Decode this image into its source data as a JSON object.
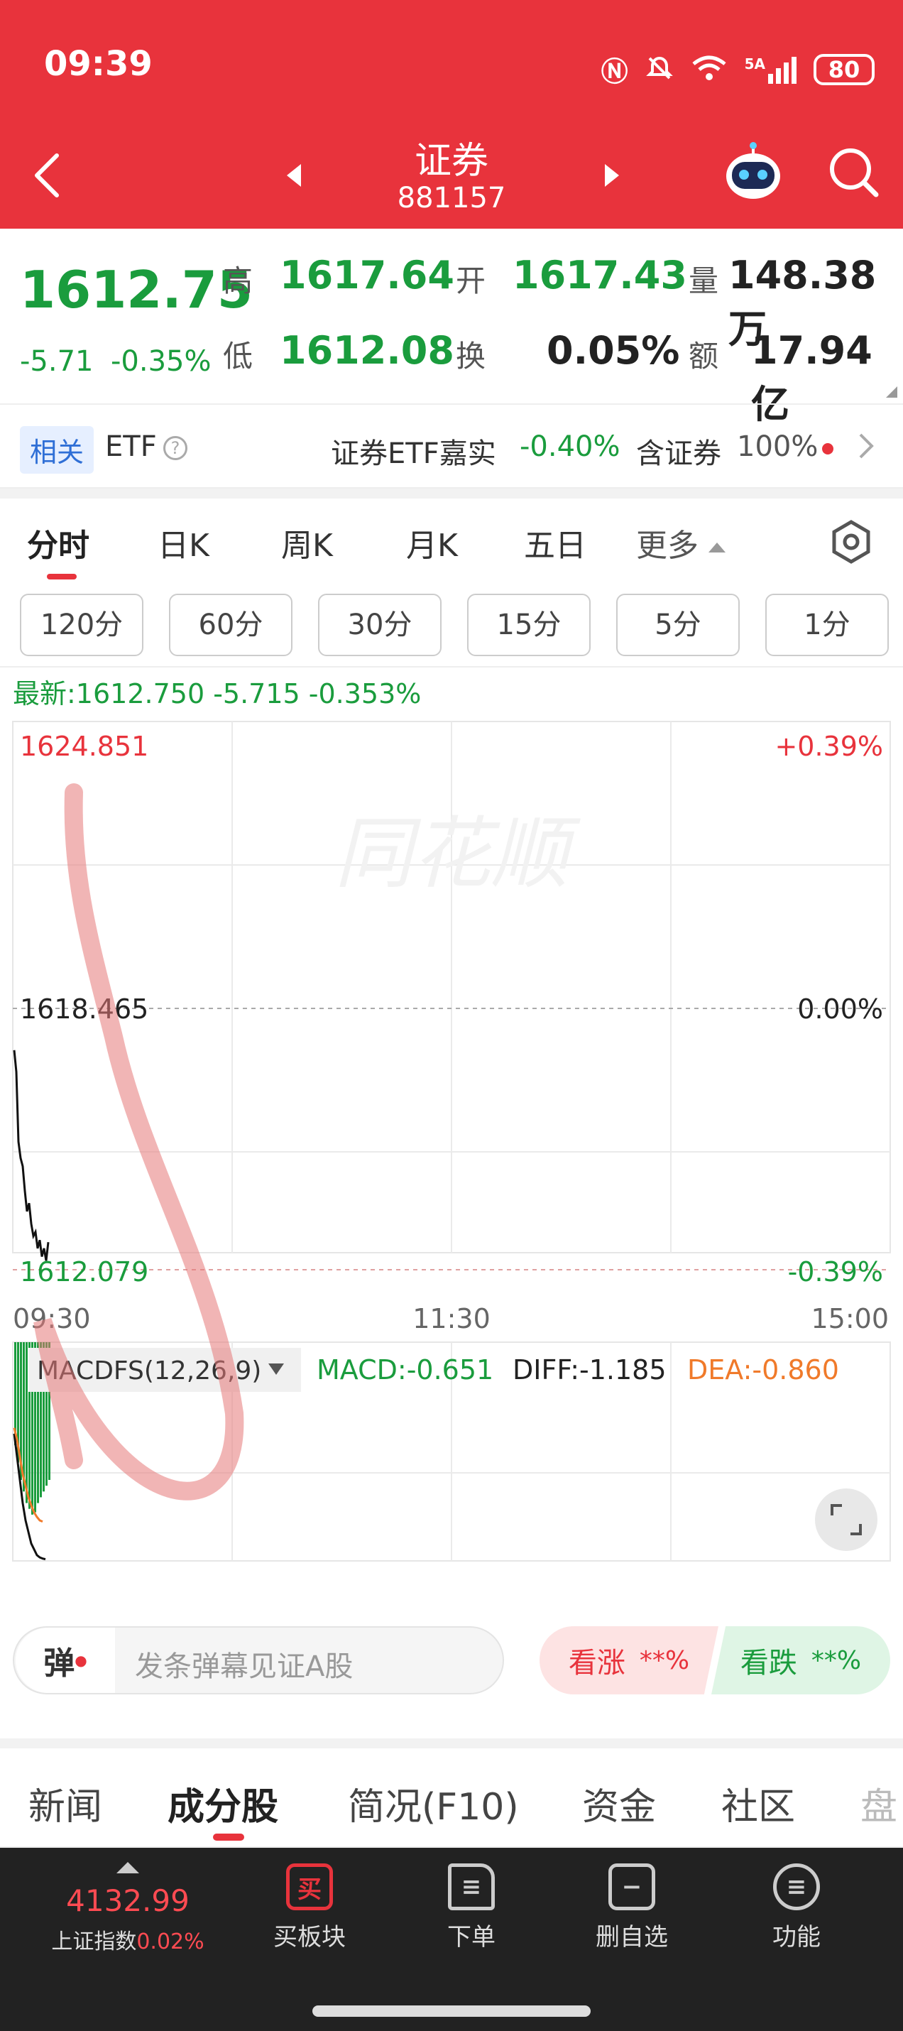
{
  "status": {
    "time": "09:39",
    "network": "5A",
    "battery": "80"
  },
  "nav": {
    "title": "证券",
    "code": "881157"
  },
  "quote": {
    "price": "1612.75",
    "change": "-5.71",
    "change_pct": "-0.35%",
    "high_label": "高",
    "high": "1617.64",
    "open_label": "开",
    "open": "1617.43",
    "volume_label": "量",
    "volume": "148.38万",
    "low_label": "低",
    "low": "1612.08",
    "turnover_label": "换",
    "turnover": "0.05%",
    "amount_label": "额",
    "amount": "17.94亿"
  },
  "related": {
    "tag": "相关",
    "etf_label": "ETF",
    "etf_name": "证券ETF嘉实",
    "etf_change": "-0.40%",
    "contain_label": "含证券",
    "contain_pct": "100%"
  },
  "period_tabs": [
    "分时",
    "日K",
    "周K",
    "月K",
    "五日",
    "更多"
  ],
  "ranges": [
    "120分",
    "60分",
    "30分",
    "15分",
    "5分",
    "1分"
  ],
  "chart_header": "最新:1612.750  -5.715  -0.353%",
  "watermark": "同花顺",
  "macd": {
    "name": "MACDFS(12,26,9)",
    "macd": "MACD:-0.651",
    "diff": "DIFF:-1.185",
    "dea": "DEA:-0.860"
  },
  "danmu": {
    "icon_label": "弹",
    "placeholder": "发条弹幕见证A股",
    "rise_label": "看涨",
    "rise_value": "**%",
    "fall_label": "看跌",
    "fall_value": "**%"
  },
  "bottom_tabs": [
    "新闻",
    "成分股",
    "简况(F10)",
    "资金",
    "社区",
    "盘"
  ],
  "bottom_bar": {
    "index_value": "4132.99",
    "index_name": "上证指数",
    "index_change": "0.02%",
    "items": [
      "买板块",
      "下单",
      "删自选",
      "功能"
    ],
    "buy_icon_label": "买"
  },
  "chart_data": {
    "type": "line",
    "title": "",
    "y_labels_left": [
      "1624.851",
      "1618.465",
      "1612.079"
    ],
    "y_labels_right": [
      "+0.39%",
      "0.00%",
      "-0.39%"
    ],
    "x_labels": [
      "09:30",
      "11:30",
      "15:00"
    ],
    "ylim": [
      1612.079,
      1624.851
    ],
    "prev_close": 1618.465,
    "series": [
      {
        "values": [
          1617.43,
          1616.9,
          1615.2,
          1614.8,
          1614.6,
          1614.0,
          1613.5,
          1613.7,
          1613.2,
          1612.9,
          1613.0,
          1612.6,
          1612.8,
          1612.4,
          1612.6,
          1612.3,
          1612.75
        ]
      }
    ],
    "macd_bars": [
      -0.2,
      -0.35,
      -0.5,
      -0.6,
      -0.7,
      -0.75,
      -0.8,
      -0.78,
      -0.7,
      -0.65,
      -0.6,
      -0.55,
      -0.5
    ],
    "macd_ylim": [
      -1.2,
      0.2
    ],
    "diff_line": [
      -0.1,
      -0.3,
      -0.5,
      -0.7,
      -0.85,
      -0.95,
      -1.05,
      -1.1,
      -1.15,
      -1.17,
      -1.18,
      -1.185
    ],
    "dea_line": [
      -0.05,
      -0.15,
      -0.3,
      -0.45,
      -0.55,
      -0.65,
      -0.72,
      -0.78,
      -0.82,
      -0.85,
      -0.86
    ]
  }
}
